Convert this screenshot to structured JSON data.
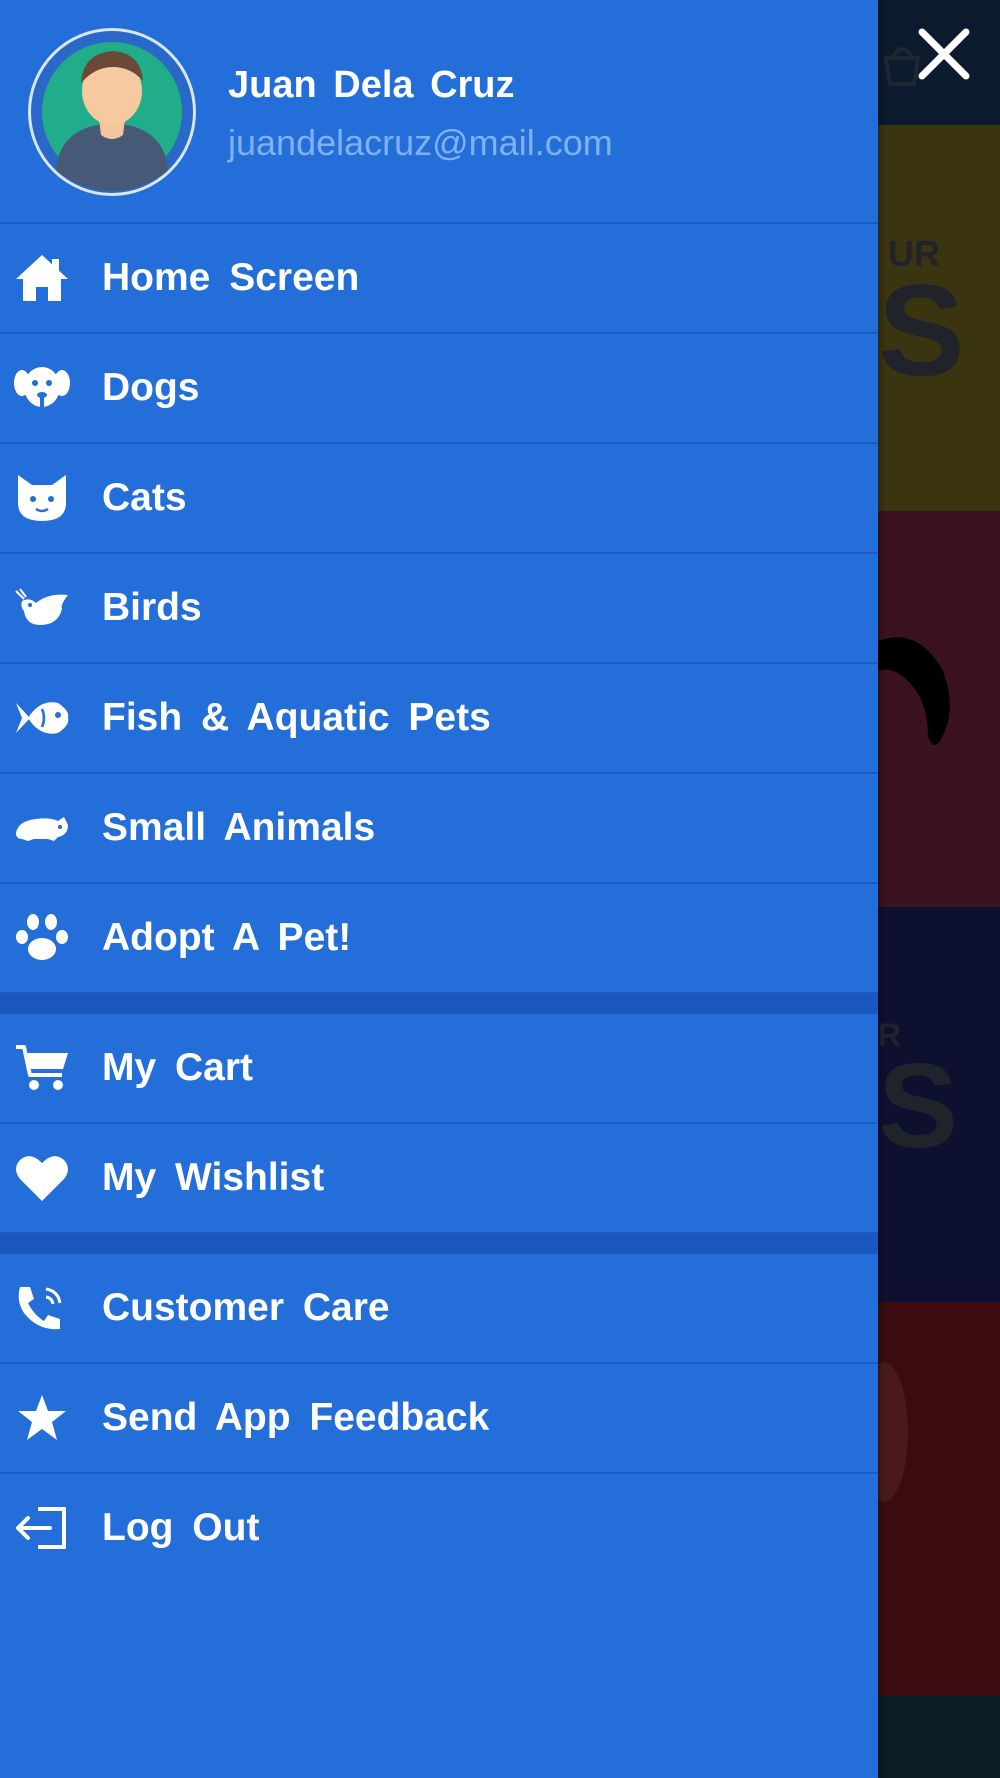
{
  "user": {
    "name": "Juan Dela Cruz",
    "email": "juandelacruz@mail.com"
  },
  "menu": {
    "primary": [
      {
        "label": "Home Screen",
        "icon": "home-icon"
      },
      {
        "label": "Dogs",
        "icon": "dog-icon"
      },
      {
        "label": "Cats",
        "icon": "cat-icon"
      },
      {
        "label": "Birds",
        "icon": "bird-icon"
      },
      {
        "label": "Fish & Aquatic Pets",
        "icon": "fish-icon"
      },
      {
        "label": "Small Animals",
        "icon": "small-animal-icon"
      },
      {
        "label": "Adopt A Pet!",
        "icon": "paw-icon"
      }
    ],
    "shopping": [
      {
        "label": "My Cart",
        "icon": "cart-icon"
      },
      {
        "label": "My Wishlist",
        "icon": "heart-icon"
      }
    ],
    "support": [
      {
        "label": "Customer Care",
        "icon": "phone-icon"
      },
      {
        "label": "Send App Feedback",
        "icon": "star-icon"
      },
      {
        "label": "Log Out",
        "icon": "logout-icon"
      }
    ]
  },
  "background": {
    "banner_top_text": "UR",
    "banner_big_text": "S",
    "banner2_top_text": "R",
    "banner2_big_text": "S"
  },
  "colors": {
    "drawer": "#236ed8",
    "divider": "#1a5cbf",
    "email": "#7fb0f2"
  }
}
